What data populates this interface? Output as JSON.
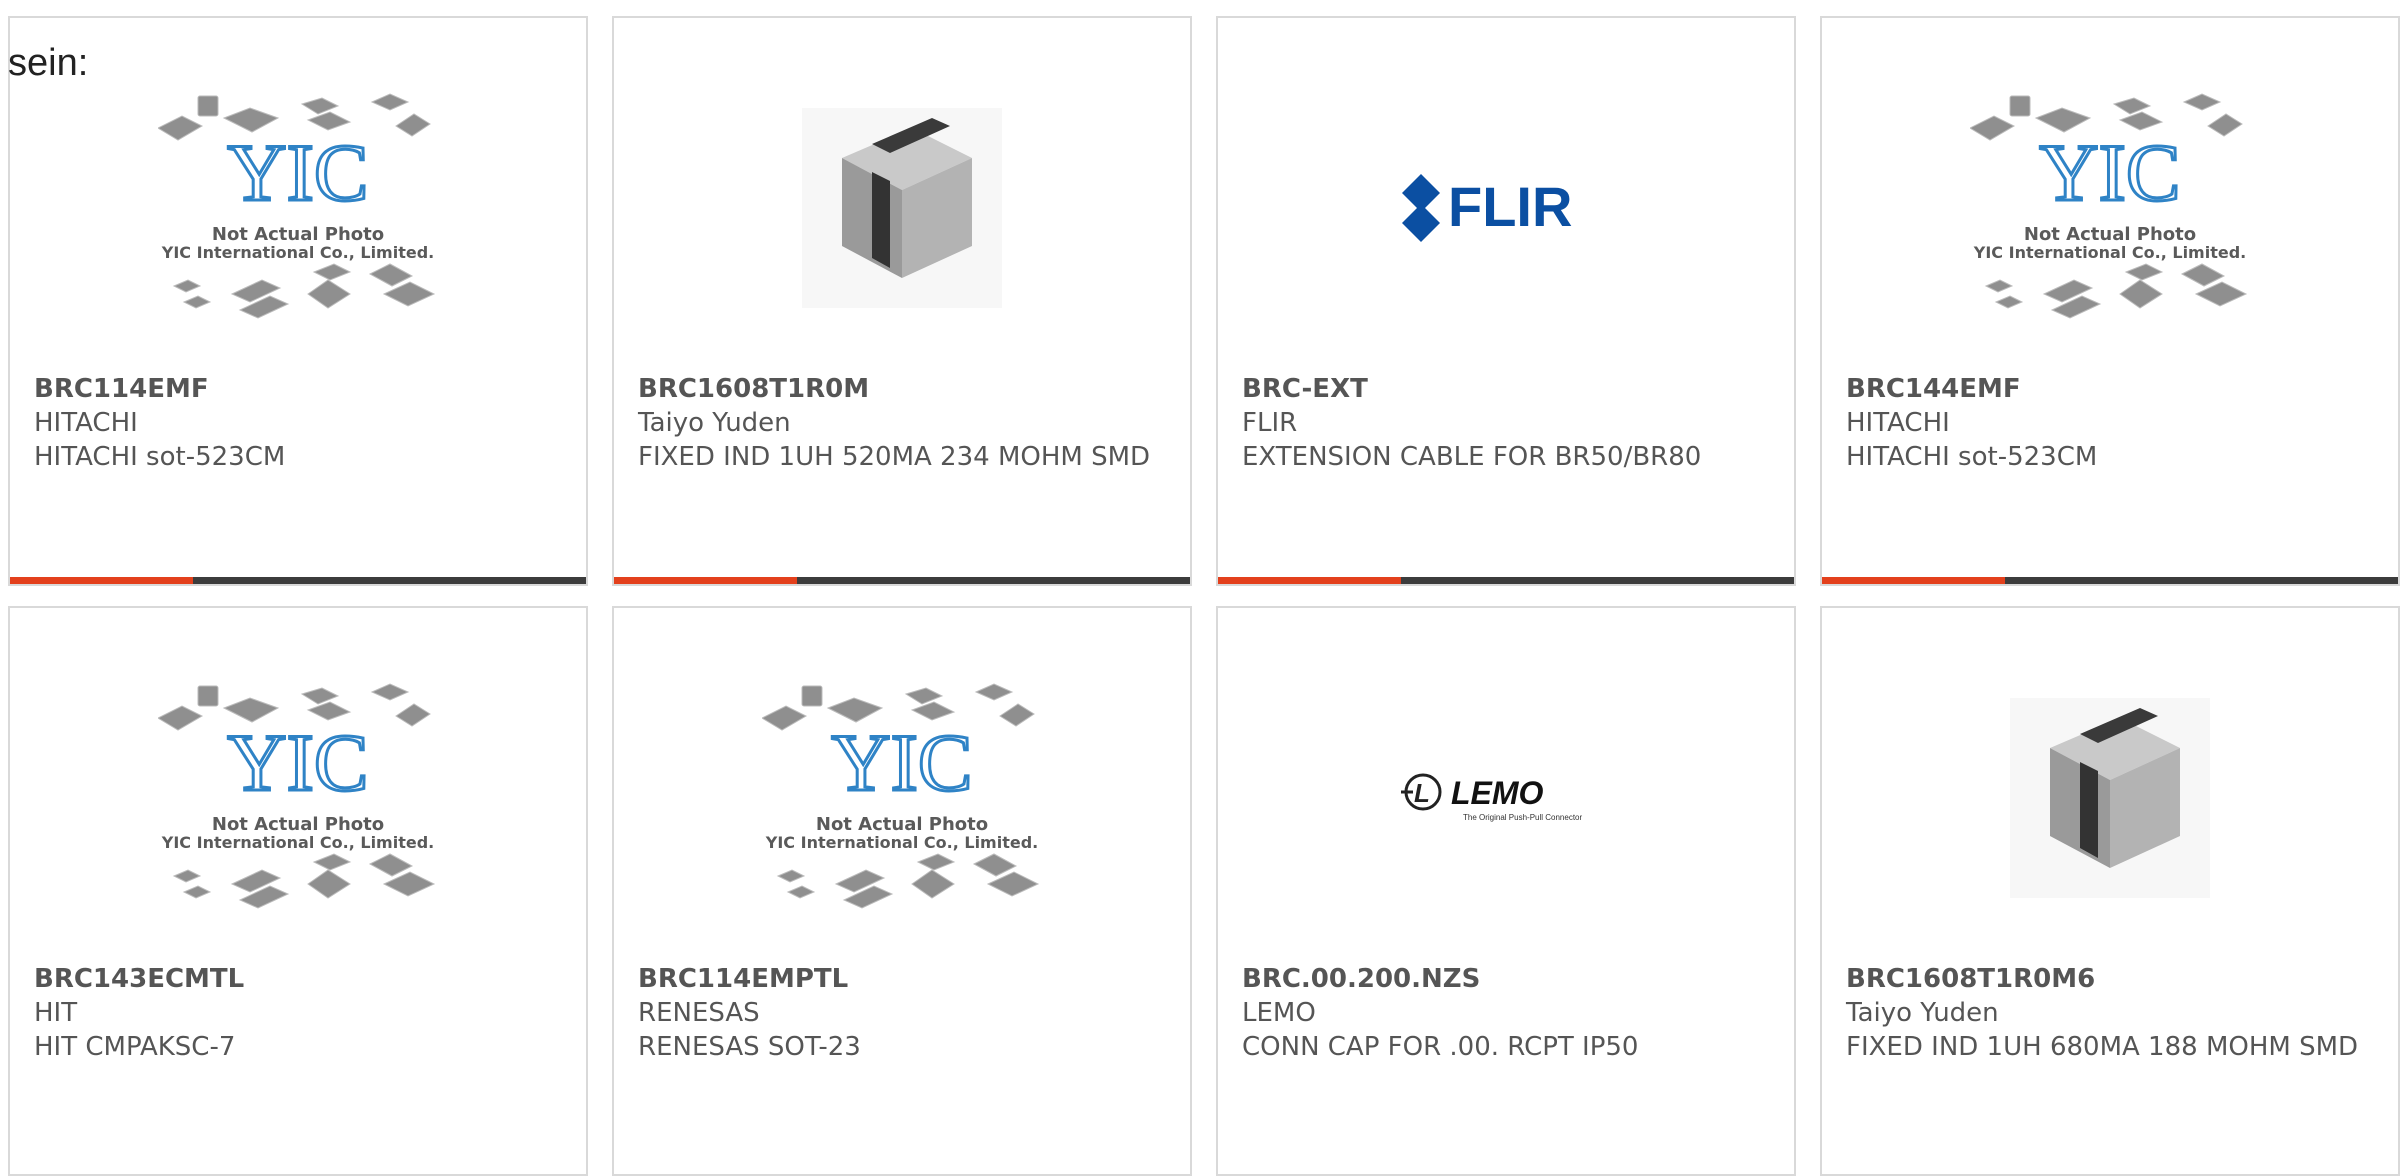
{
  "lead_text": "sein:",
  "colors": {
    "accent": "#e3401c",
    "bar": "#3c3c3c",
    "border": "#d9d9d9",
    "text": "#555555",
    "flir_blue": "#0b4fa2",
    "yic_blue": "#2f83c6"
  },
  "placeholder": {
    "line1": "Not Actual Photo",
    "line2": "YIC International Co., Limited.",
    "logo": "YIC"
  },
  "products": [
    {
      "part": "BRC114EMF",
      "maker": "HITACHI",
      "desc": "HITACHI sot-523CM",
      "image": "yic-placeholder"
    },
    {
      "part": "BRC1608T1R0M",
      "maker": "Taiyo Yuden",
      "desc": "FIXED IND 1UH 520MA 234 MOHM SMD",
      "image": "smd-inductor"
    },
    {
      "part": "BRC-EXT",
      "maker": "FLIR",
      "desc": "EXTENSION CABLE FOR BR50/BR80",
      "image": "flir-logo"
    },
    {
      "part": "BRC144EMF",
      "maker": "HITACHI",
      "desc": "HITACHI sot-523CM",
      "image": "yic-placeholder"
    },
    {
      "part": "BRC143ECMTL",
      "maker": "HIT",
      "desc": "HIT CMPAKSC-7",
      "image": "yic-placeholder"
    },
    {
      "part": "BRC114EMPTL",
      "maker": "RENESAS",
      "desc": "RENESAS SOT-23",
      "image": "yic-placeholder"
    },
    {
      "part": "BRC.00.200.NZS",
      "maker": "LEMO",
      "desc": "CONN CAP FOR .00. RCPT IP50",
      "image": "lemo-logo"
    },
    {
      "part": "BRC1608T1R0M6",
      "maker": "Taiyo Yuden",
      "desc": "FIXED IND 1UH 680MA 188 MOHM SMD",
      "image": "smd-inductor"
    }
  ],
  "logos": {
    "flir": "FLIR",
    "lemo": "LEMO",
    "lemo_tagline": "The Original Push-Pull Connector"
  }
}
